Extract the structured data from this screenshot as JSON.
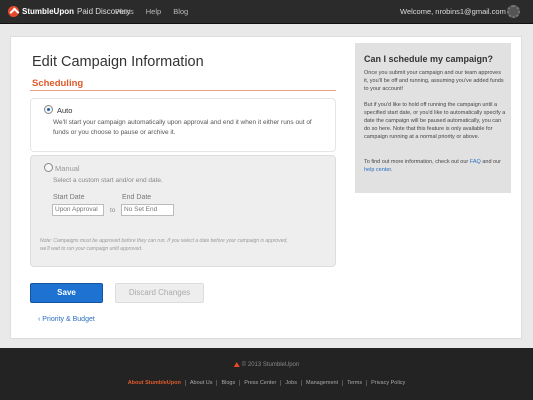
{
  "topbar": {
    "brand": "StumbleUpon",
    "product": "Paid Discovery",
    "nav": [
      "Plans",
      "Help",
      "Blog"
    ],
    "welcome": "Welcome,  nrobins1@gmail.com"
  },
  "page": {
    "title": "Edit Campaign Information",
    "section": "Scheduling"
  },
  "auto_option": {
    "label": "Auto",
    "selected": true,
    "desc_line1": "We'll start your campaign automatically upon approval and end it when it either runs out of",
    "desc_line2": "funds or you choose to pause or archive it."
  },
  "manual_option": {
    "label": "Manual",
    "selected": false,
    "desc": "Select a custom start and/or end date.",
    "start_label": "Start Date",
    "start_value": "Upon Approval",
    "to": "to",
    "end_label": "End Date",
    "end_value": "No Set End",
    "note_line1": "Note: Campaigns must be approved before they can run. If you select a date before your campaign is approved,",
    "note_line2": "we'll wait to run your campaign until approved."
  },
  "actions": {
    "save": "Save",
    "discard": "Discard Changes",
    "back": "‹ Priority & Budget"
  },
  "help": {
    "title": "Can I schedule my campaign?",
    "p1": "Once you submit your campaign and our team approves it, you'll be off and running, assuming you've added funds to your account!",
    "p2": "But if you'd like to hold off running the campaign until a specified start date, or you'd like to automatically specify a date the campaign will be paused automatically, you can do so here. Note that this feature is only available for campaign running at a normal priority or above.",
    "p3_pre": "To find out more information, check out our ",
    "p3_link1": "FAQ",
    "p3_mid": " and our ",
    "p3_link2": "help center",
    "p3_post": "."
  },
  "footer": {
    "copyright": "© 2013 StumbleUpon",
    "links": [
      "About StumbleUpon",
      "About Us",
      "Blogs",
      "Press Center",
      "Jobs",
      "Management",
      "Terms",
      "Privacy Policy"
    ]
  },
  "colors": {
    "accent": "#e05a2b",
    "primary_button": "#1e73d2",
    "link": "#2a6fc0"
  }
}
